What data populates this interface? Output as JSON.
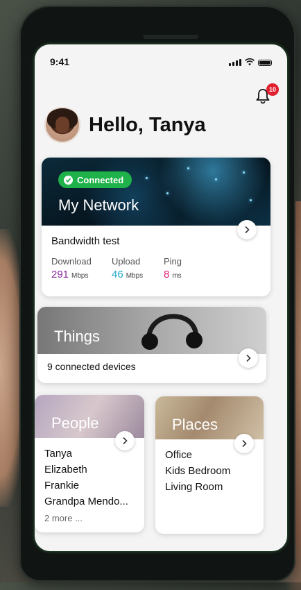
{
  "status_bar": {
    "time": "9:41"
  },
  "notifications": {
    "count": "10"
  },
  "greeting": "Hello, Tanya",
  "network_card": {
    "status_label": "Connected",
    "title": "My Network",
    "bandwidth_title": "Bandwidth test",
    "stats": [
      {
        "label": "Download",
        "value": "291",
        "unit": "Mbps",
        "color": "#8a2d9c"
      },
      {
        "label": "Upload",
        "value": "46",
        "unit": "Mbps",
        "color": "#1fa8c7"
      },
      {
        "label": "Ping",
        "value": "8",
        "unit": "ms",
        "color": "#e0207a"
      }
    ]
  },
  "things_card": {
    "title": "Things",
    "subtitle": "9 connected devices"
  },
  "people_card": {
    "title": "People",
    "items": [
      "Tanya",
      "Elizabeth",
      "Frankie",
      "Grandpa Mendo..."
    ],
    "more": "2 more ..."
  },
  "places_card": {
    "title": "Places",
    "items": [
      "Office",
      "Kids Bedroom",
      "Living Room"
    ]
  },
  "colors": {
    "accent_green": "#1fb24a",
    "badge_red": "#e0202f"
  },
  "icons": [
    "bell-icon",
    "check-circle-icon",
    "chevron-right-icon",
    "signal-icon",
    "wifi-icon",
    "battery-icon"
  ]
}
